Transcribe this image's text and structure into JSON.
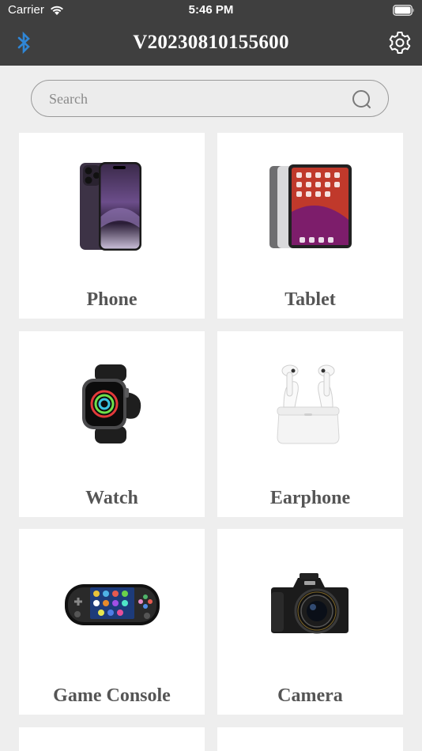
{
  "status_bar": {
    "carrier": "Carrier",
    "time": "5:46 PM"
  },
  "nav": {
    "title": "V20230810155600"
  },
  "search": {
    "placeholder": "Search"
  },
  "categories": [
    {
      "label": "Phone",
      "icon": "phone-image"
    },
    {
      "label": "Tablet",
      "icon": "tablet-image"
    },
    {
      "label": "Watch",
      "icon": "watch-image"
    },
    {
      "label": "Earphone",
      "icon": "earphone-image"
    },
    {
      "label": "Game Console",
      "icon": "game-console-image"
    },
    {
      "label": "Camera",
      "icon": "camera-image"
    }
  ],
  "colors": {
    "topbar": "#3f3f3f",
    "accent": "#2f86d6",
    "background": "#eeeeee",
    "label": "#555555"
  }
}
